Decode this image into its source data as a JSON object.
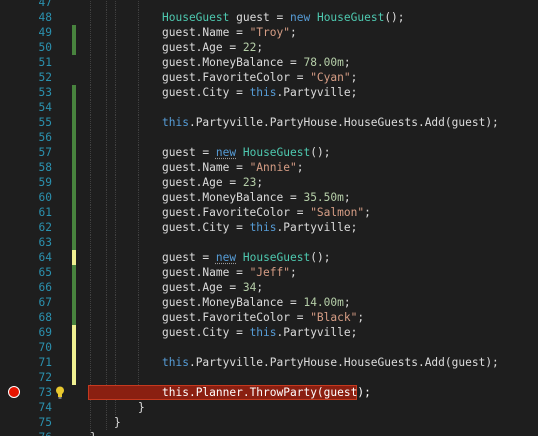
{
  "editor": {
    "language": "C#",
    "breakpoint_line": "73",
    "lightbulb_line": "73",
    "colors": {
      "background": "#1e1e1e",
      "line_number": "#2b91af",
      "keyword": "#569cd6",
      "type": "#4ec9b0",
      "string": "#d69d85",
      "number": "#b5cea8",
      "breakpoint": "#e51400",
      "change_saved": "#57a64a",
      "change_unsaved": "#efef91"
    },
    "lines": [
      {
        "num": "47",
        "change": "",
        "tokens": []
      },
      {
        "num": "48",
        "change": "",
        "tokens": [
          {
            "t": "type",
            "v": "HouseGuest"
          },
          {
            "t": "id",
            "v": " guest = "
          },
          {
            "t": "kw",
            "v": "new"
          },
          {
            "t": "id",
            "v": " "
          },
          {
            "t": "type",
            "v": "HouseGuest"
          },
          {
            "t": "p",
            "v": "();"
          }
        ]
      },
      {
        "num": "49",
        "change": "saved",
        "tokens": [
          {
            "t": "id",
            "v": "guest.Name = "
          },
          {
            "t": "str",
            "v": "\"Troy\""
          },
          {
            "t": "p",
            "v": ";"
          }
        ]
      },
      {
        "num": "50",
        "change": "saved",
        "tokens": [
          {
            "t": "id",
            "v": "guest.Age = "
          },
          {
            "t": "num",
            "v": "22"
          },
          {
            "t": "p",
            "v": ";"
          }
        ]
      },
      {
        "num": "51",
        "change": "",
        "tokens": [
          {
            "t": "id",
            "v": "guest.MoneyBalance = "
          },
          {
            "t": "num",
            "v": "78.00m"
          },
          {
            "t": "p",
            "v": ";"
          }
        ]
      },
      {
        "num": "52",
        "change": "",
        "tokens": [
          {
            "t": "id",
            "v": "guest.FavoriteColor = "
          },
          {
            "t": "str",
            "v": "\"Cyan\""
          },
          {
            "t": "p",
            "v": ";"
          }
        ]
      },
      {
        "num": "53",
        "change": "saved",
        "tokens": [
          {
            "t": "id",
            "v": "guest.City = "
          },
          {
            "t": "kw",
            "v": "this"
          },
          {
            "t": "id",
            "v": ".Partyville;"
          }
        ]
      },
      {
        "num": "54",
        "change": "saved",
        "tokens": []
      },
      {
        "num": "55",
        "change": "saved",
        "tokens": [
          {
            "t": "kw",
            "v": "this"
          },
          {
            "t": "id",
            "v": ".Partyville.PartyHouse.HouseGuests.Add(guest);"
          }
        ]
      },
      {
        "num": "56",
        "change": "saved",
        "tokens": []
      },
      {
        "num": "57",
        "change": "saved",
        "tokens": [
          {
            "t": "id",
            "v": "guest = "
          },
          {
            "t": "kw",
            "v": "new",
            "squig": true
          },
          {
            "t": "id",
            "v": " "
          },
          {
            "t": "type",
            "v": "HouseGuest"
          },
          {
            "t": "p",
            "v": "();"
          }
        ]
      },
      {
        "num": "58",
        "change": "saved",
        "tokens": [
          {
            "t": "id",
            "v": "guest.Name = "
          },
          {
            "t": "str",
            "v": "\"Annie\""
          },
          {
            "t": "p",
            "v": ";"
          }
        ]
      },
      {
        "num": "59",
        "change": "saved",
        "tokens": [
          {
            "t": "id",
            "v": "guest.Age = "
          },
          {
            "t": "num",
            "v": "23"
          },
          {
            "t": "p",
            "v": ";"
          }
        ]
      },
      {
        "num": "60",
        "change": "saved",
        "tokens": [
          {
            "t": "id",
            "v": "guest.MoneyBalance = "
          },
          {
            "t": "num",
            "v": "35.50m"
          },
          {
            "t": "p",
            "v": ";"
          }
        ]
      },
      {
        "num": "61",
        "change": "saved",
        "tokens": [
          {
            "t": "id",
            "v": "guest.FavoriteColor = "
          },
          {
            "t": "str",
            "v": "\"Salmon\""
          },
          {
            "t": "p",
            "v": ";"
          }
        ]
      },
      {
        "num": "62",
        "change": "saved",
        "tokens": [
          {
            "t": "id",
            "v": "guest.City = "
          },
          {
            "t": "kw",
            "v": "this"
          },
          {
            "t": "id",
            "v": ".Partyville;"
          }
        ]
      },
      {
        "num": "63",
        "change": "saved",
        "tokens": []
      },
      {
        "num": "64",
        "change": "unsaved",
        "tokens": [
          {
            "t": "id",
            "v": "guest = "
          },
          {
            "t": "kw",
            "v": "new",
            "squig": true
          },
          {
            "t": "id",
            "v": " "
          },
          {
            "t": "type",
            "v": "HouseGuest"
          },
          {
            "t": "p",
            "v": "();"
          }
        ]
      },
      {
        "num": "65",
        "change": "saved",
        "tokens": [
          {
            "t": "id",
            "v": "guest.Name = "
          },
          {
            "t": "str",
            "v": "\"Jeff\""
          },
          {
            "t": "p",
            "v": ";"
          }
        ]
      },
      {
        "num": "66",
        "change": "saved",
        "tokens": [
          {
            "t": "id",
            "v": "guest.Age = "
          },
          {
            "t": "num",
            "v": "34"
          },
          {
            "t": "p",
            "v": ";"
          }
        ]
      },
      {
        "num": "67",
        "change": "saved",
        "tokens": [
          {
            "t": "id",
            "v": "guest.MoneyBalance = "
          },
          {
            "t": "num",
            "v": "14.00m"
          },
          {
            "t": "p",
            "v": ";"
          }
        ]
      },
      {
        "num": "68",
        "change": "saved",
        "tokens": [
          {
            "t": "id",
            "v": "guest.FavoriteColor = "
          },
          {
            "t": "str",
            "v": "\"Black\""
          },
          {
            "t": "p",
            "v": ";"
          }
        ]
      },
      {
        "num": "69",
        "change": "unsaved",
        "tokens": [
          {
            "t": "id",
            "v": "guest.City = "
          },
          {
            "t": "kw",
            "v": "this"
          },
          {
            "t": "id",
            "v": ".Partyville;"
          }
        ]
      },
      {
        "num": "70",
        "change": "unsaved",
        "tokens": []
      },
      {
        "num": "71",
        "change": "unsaved",
        "tokens": [
          {
            "t": "kw",
            "v": "this"
          },
          {
            "t": "id",
            "v": ".Partyville.PartyHouse.HouseGuests.Add(guest);"
          }
        ]
      },
      {
        "num": "72",
        "change": "unsaved",
        "tokens": []
      },
      {
        "num": "73",
        "change": "",
        "breakpoint": true,
        "bulb": true,
        "tokens": [
          {
            "t": "kw",
            "v": "this"
          },
          {
            "t": "id",
            "v": ".Planner.ThrowParty(guest);"
          }
        ]
      },
      {
        "num": "74",
        "change": "",
        "indent": 1,
        "tokens": [
          {
            "t": "p",
            "v": "}"
          }
        ]
      },
      {
        "num": "75",
        "change": "",
        "indent": 2,
        "tokens": [
          {
            "t": "p",
            "v": "}"
          }
        ]
      },
      {
        "num": "76",
        "change": "",
        "indent": 3,
        "tokens": [
          {
            "t": "p",
            "v": "}"
          }
        ]
      }
    ]
  }
}
